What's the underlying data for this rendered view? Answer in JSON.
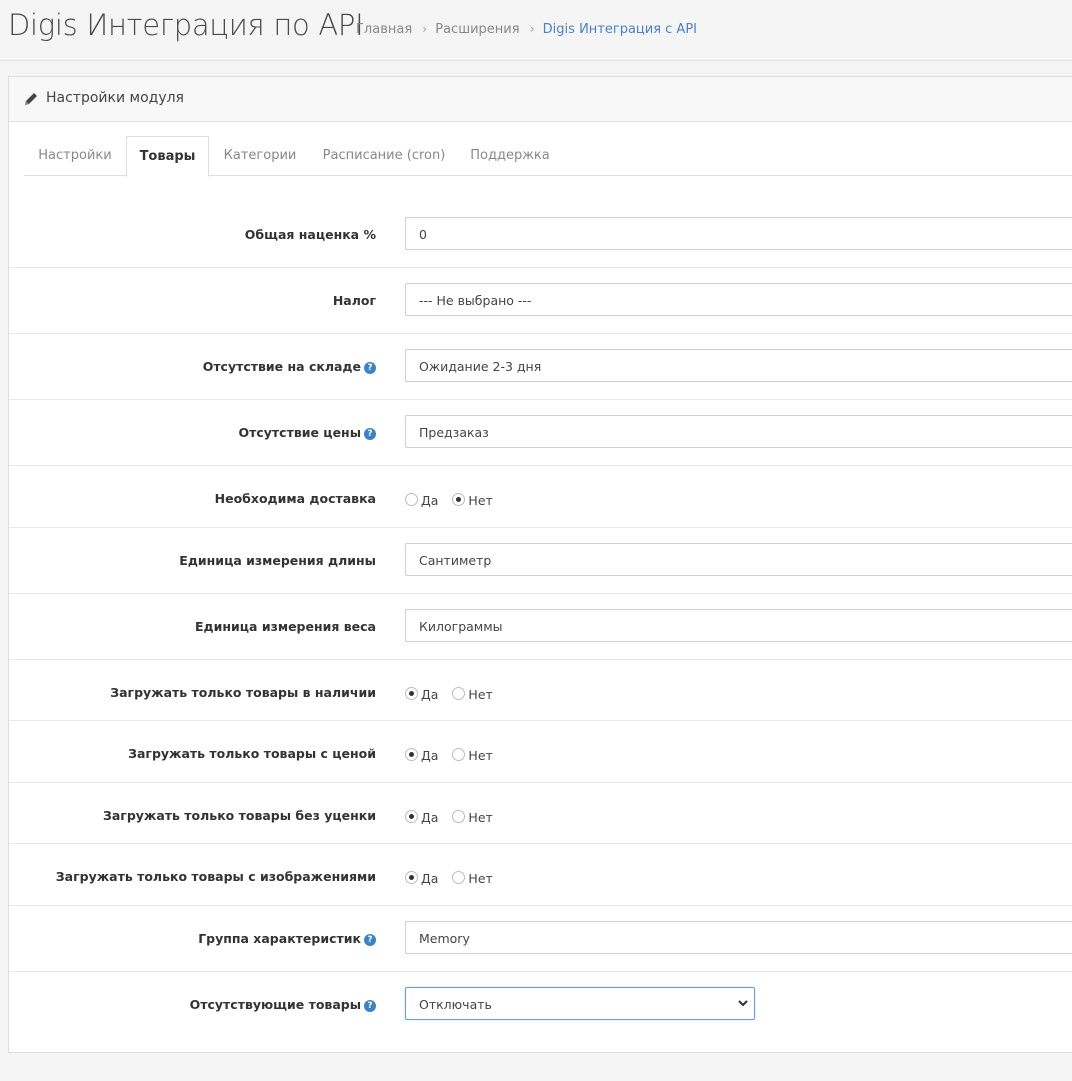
{
  "header": {
    "title": "Digis Интеграция по API",
    "breadcrumb": [
      "Главная",
      "Расширения",
      "Digis Интеграция с API"
    ]
  },
  "panel": {
    "title": "Настройки модуля",
    "icon": "pencil-icon"
  },
  "tabs": [
    {
      "label": "Настройки",
      "active": false
    },
    {
      "label": "Товары",
      "active": true
    },
    {
      "label": "Категории",
      "active": false
    },
    {
      "label": "Расписание (cron)",
      "active": false
    },
    {
      "label": "Поддержка",
      "active": false
    }
  ],
  "form": {
    "markup_label": "Общая наценка %",
    "markup_value": "0",
    "tax_label": "Налог",
    "tax_value": "--- Не выбрано ---",
    "out_of_stock_label": "Отсутствие на складе",
    "out_of_stock_value": "Ожидание 2-3 дня",
    "no_price_label": "Отсутствие цены",
    "no_price_value": "Предзаказ",
    "shipping_label": "Необходима доставка",
    "length_label": "Единица измерения длины",
    "length_value": "Сантиметр",
    "weight_label": "Единица измерения веса",
    "weight_value": "Килограммы",
    "in_stock_only_label": "Загружать только товары в наличии",
    "with_price_only_label": "Загружать только товары с ценой",
    "no_discount_only_label": "Загружать только товары без уценки",
    "with_images_only_label": "Загружать только товары с изображениями",
    "attr_group_label": "Группа характеристик",
    "attr_group_value": "Memory",
    "missing_products_label": "Отсутствующие товары",
    "missing_products_value": "Отключать",
    "yes": "Да",
    "no": "Нет",
    "help_glyph": "?"
  },
  "radio_state": {
    "shipping": "no",
    "in_stock_only": "yes",
    "with_price_only": "yes",
    "no_discount_only": "yes",
    "with_images_only": "yes"
  },
  "colors": {
    "accent": "#4a82c0",
    "help_icon": "#3b83c6"
  }
}
